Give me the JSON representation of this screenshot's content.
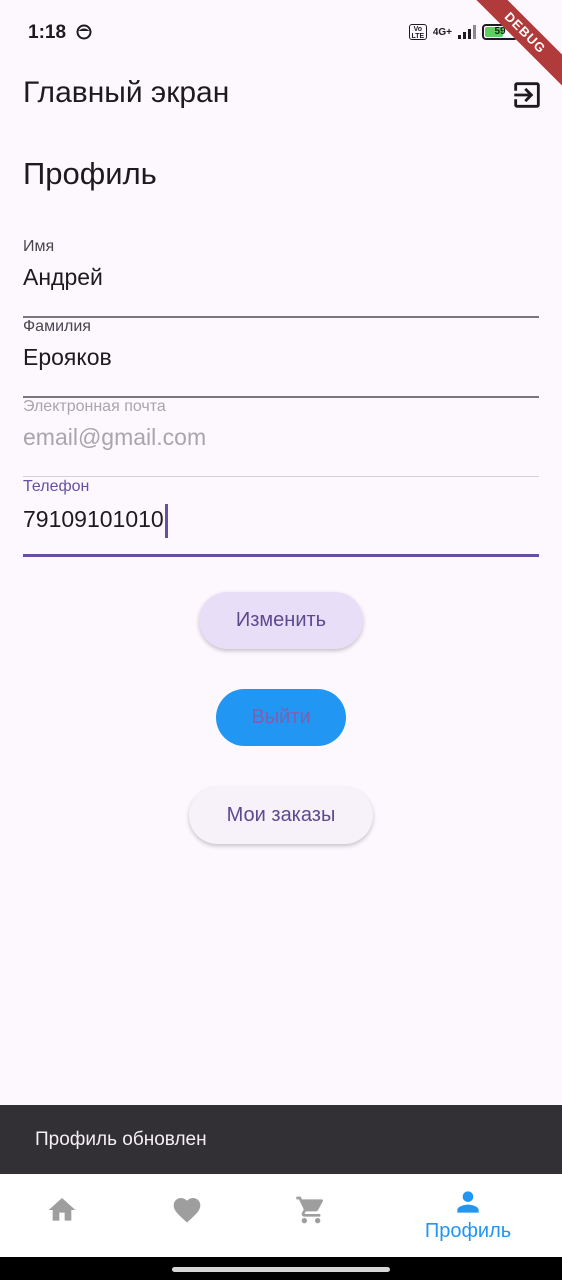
{
  "status_bar": {
    "time": "1:18",
    "network": "4G+",
    "volte": "Vo LTE",
    "battery": "59",
    "battery_level": 0.59,
    "debug_banner": "DEBUG"
  },
  "app_bar": {
    "title": "Главный экран",
    "action_icon": "logout-icon"
  },
  "page": {
    "title": "Профиль"
  },
  "form": {
    "first_name": {
      "label": "Имя",
      "value": "Андрей"
    },
    "last_name": {
      "label": "Фамилия",
      "value": "Ерояков"
    },
    "email": {
      "label": "Электронная почта",
      "placeholder": "email@gmail.com"
    },
    "phone": {
      "label": "Телефон",
      "value": "79109101010"
    }
  },
  "buttons": {
    "edit": "Изменить",
    "logout": "Выйти",
    "orders": "Мои заказы"
  },
  "snackbar": {
    "message": "Профиль обновлен"
  },
  "bottom_nav": {
    "items": [
      {
        "icon": "home-icon",
        "label": ""
      },
      {
        "icon": "heart-icon",
        "label": ""
      },
      {
        "icon": "cart-icon",
        "label": ""
      },
      {
        "icon": "person-icon",
        "label": "Профиль",
        "selected": true
      }
    ]
  },
  "colors": {
    "background": "#FDF7FE",
    "primary": "#6750A4",
    "accent_blue": "#2196F3",
    "snackbar": "#322F35",
    "inactive_icon": "#9E9E9E"
  }
}
